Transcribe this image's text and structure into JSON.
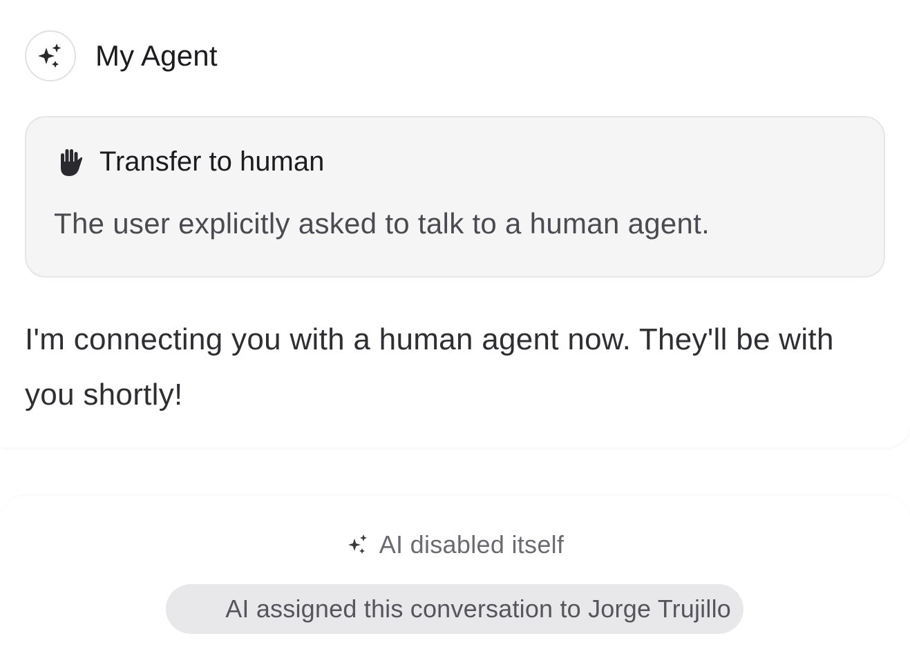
{
  "agent": {
    "name": "My Agent",
    "avatar_icon": "sparkles-icon"
  },
  "transfer": {
    "icon": "hand-icon",
    "title": "Transfer to human",
    "description": "The user explicitly asked to talk to a human agent."
  },
  "reply": {
    "text": "I'm connecting you with a human agent now. They'll be with you shortly!"
  },
  "events": {
    "ai_disabled": {
      "icon": "sparkles-icon",
      "label": "AI disabled itself"
    },
    "assigned": {
      "label": "AI assigned this conversation to Jorge Trujillo"
    }
  },
  "colors": {
    "text_primary": "#1c1c1f",
    "text_secondary": "#4a4a50",
    "card_bg": "#f5f5f6",
    "pill_bg": "#e8e8ea"
  }
}
